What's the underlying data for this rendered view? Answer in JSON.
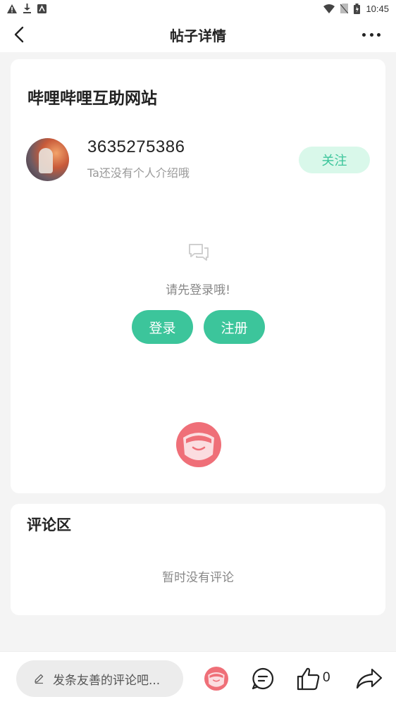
{
  "status_bar": {
    "time": "10:45",
    "left_icons": [
      "warning-icon",
      "download-icon",
      "text-icon"
    ],
    "right_icons": [
      "wifi-icon",
      "no-sim-icon",
      "battery-icon"
    ]
  },
  "header": {
    "title": "帖子详情",
    "back_icon": "back-arrow-icon",
    "more_icon": "more-dots-icon"
  },
  "post": {
    "title": "哔哩哔哩互助网站",
    "author": {
      "username": "3635275386",
      "bio": "Ta还没有个人介绍哦"
    },
    "follow_label": "关注",
    "login_tip": "请先登录哦!",
    "login_label": "登录",
    "register_label": "注册"
  },
  "comments": {
    "title": "评论区",
    "empty_text": "暂时没有评论"
  },
  "bottom_bar": {
    "input_placeholder": "发条友善的评论吧...",
    "like_count": "0"
  },
  "colors": {
    "accent": "#3cc59b",
    "follow_bg": "#d9f8ea",
    "page_bg": "#f4f4f4",
    "mascot": "#ef6f78"
  }
}
